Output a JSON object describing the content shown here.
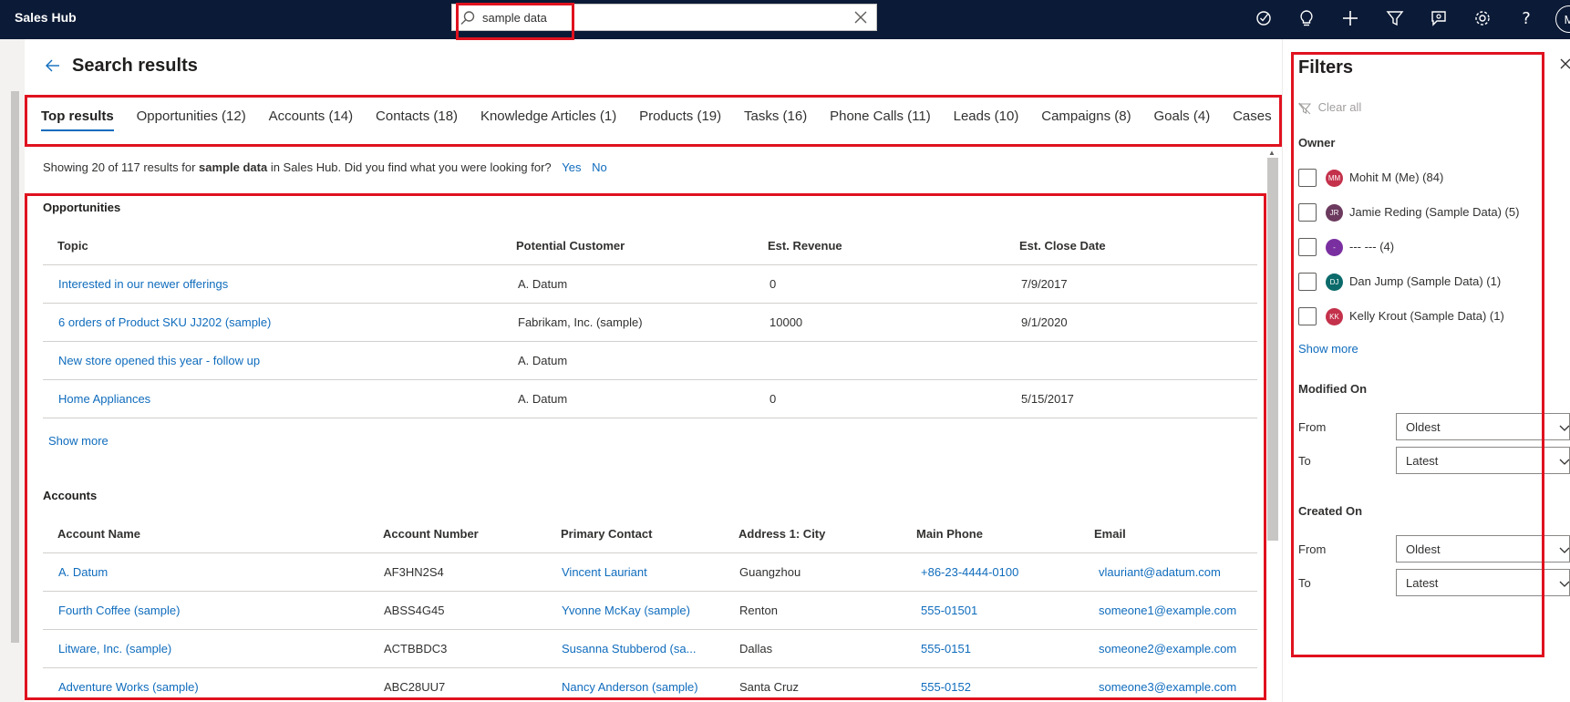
{
  "app": {
    "name": "Sales Hub",
    "avatar_initials": "M"
  },
  "search": {
    "value": "sample data"
  },
  "page": {
    "title": "Search results"
  },
  "tabs": [
    {
      "label": "Top results"
    },
    {
      "label": "Opportunities (12)"
    },
    {
      "label": "Accounts (14)"
    },
    {
      "label": "Contacts (18)"
    },
    {
      "label": "Knowledge Articles (1)"
    },
    {
      "label": "Products (19)"
    },
    {
      "label": "Tasks (16)"
    },
    {
      "label": "Phone Calls (11)"
    },
    {
      "label": "Leads (10)"
    },
    {
      "label": "Campaigns (8)"
    },
    {
      "label": "Goals (4)"
    },
    {
      "label": "Cases"
    }
  ],
  "info": {
    "prefix": "Showing 20 of 117 results for",
    "query": "sample data",
    "suffix": "in Sales Hub. Did you find what you were looking for?",
    "yes": "Yes",
    "no": "No"
  },
  "opportunities": {
    "title": "Opportunities",
    "columns": [
      "Topic",
      "Potential Customer",
      "Est. Revenue",
      "Est. Close Date"
    ],
    "rows": [
      [
        "Interested in our newer offerings",
        "A. Datum",
        "0",
        "7/9/2017"
      ],
      [
        "6 orders of Product SKU JJ202 (sample)",
        "Fabrikam, Inc. (sample)",
        "10000",
        "9/1/2020"
      ],
      [
        "New store opened this year - follow up",
        "A. Datum",
        "",
        ""
      ],
      [
        "Home Appliances",
        "A. Datum",
        "0",
        "5/15/2017"
      ]
    ],
    "show_more": "Show more"
  },
  "accounts": {
    "title": "Accounts",
    "columns": [
      "Account Name",
      "Account Number",
      "Primary Contact",
      "Address 1: City",
      "Main Phone",
      "Email"
    ],
    "rows": [
      [
        "A. Datum",
        "AF3HN2S4",
        "Vincent Lauriant",
        "Guangzhou",
        "+86-23-4444-0100",
        "vlauriant@adatum.com"
      ],
      [
        "Fourth Coffee (sample)",
        "ABSS4G45",
        "Yvonne McKay (sample)",
        "Renton",
        "555-01501",
        "someone1@example.com"
      ],
      [
        "Litware, Inc. (sample)",
        "ACTBBDC3",
        "Susanna Stubberod (sa...",
        "Dallas",
        "555-0151",
        "someone2@example.com"
      ],
      [
        "Adventure Works (sample)",
        "ABC28UU7",
        "Nancy Anderson (sample)",
        "Santa Cruz",
        "555-0152",
        "someone3@example.com"
      ]
    ]
  },
  "filters": {
    "title": "Filters",
    "clear_all": "Clear all",
    "owner_label": "Owner",
    "owners": [
      {
        "initials": "MM",
        "name": "Mohit M (Me) (84)",
        "color": "#c4314b"
      },
      {
        "initials": "JR",
        "name": "Jamie Reding (Sample Data) (5)",
        "color": "#6b3a5e"
      },
      {
        "initials": "-",
        "name": "--- --- (4)",
        "color": "#7a2fa0"
      },
      {
        "initials": "DJ",
        "name": "Dan Jump (Sample Data) (1)",
        "color": "#0b6a6a"
      },
      {
        "initials": "KK",
        "name": "Kelly Krout (Sample Data) (1)",
        "color": "#c4314b"
      }
    ],
    "show_more": "Show more",
    "modified_on": "Modified On",
    "created_on": "Created On",
    "from_label": "From",
    "to_label": "To",
    "from_value": "Oldest",
    "to_value": "Latest"
  },
  "colors": {
    "topbar": "#0b1a36",
    "link": "#0f6cbd",
    "highlight": "#e0121f"
  }
}
